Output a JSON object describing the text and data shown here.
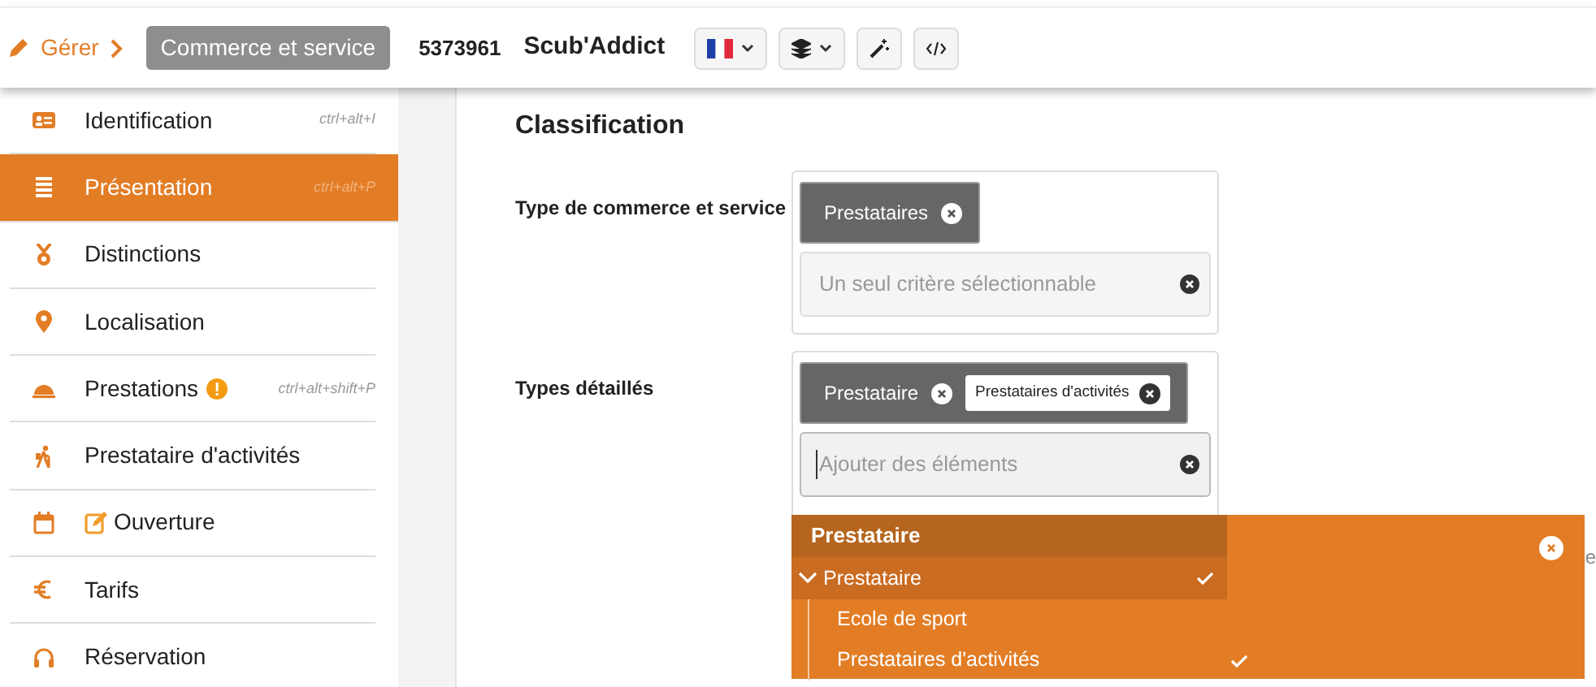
{
  "topbar": {
    "manage_link": "Gérer",
    "type_badge": "Commerce et service",
    "record_id": "5373961",
    "record_name": "Scub'Addict"
  },
  "sidebar": {
    "items": [
      {
        "label": "Identification",
        "shortcut": "ctrl+alt+I",
        "selected": false,
        "warning": false,
        "edit_marker": false
      },
      {
        "label": "Présentation",
        "shortcut": "ctrl+alt+P",
        "selected": true,
        "warning": false,
        "edit_marker": false
      },
      {
        "label": "Distinctions",
        "selected": false,
        "warning": false,
        "edit_marker": false
      },
      {
        "label": "Localisation",
        "selected": false,
        "warning": false,
        "edit_marker": false
      },
      {
        "label": "Prestations",
        "shortcut": "ctrl+alt+shift+P",
        "selected": false,
        "warning": true,
        "edit_marker": false
      },
      {
        "label": "Prestataire d'activités",
        "selected": false,
        "warning": false,
        "edit_marker": false
      },
      {
        "label": "Ouverture",
        "selected": false,
        "warning": false,
        "edit_marker": true
      },
      {
        "label": "Tarifs",
        "selected": false,
        "warning": false,
        "edit_marker": false
      },
      {
        "label": "Réservation",
        "selected": false,
        "warning": false,
        "edit_marker": false
      }
    ]
  },
  "section": {
    "title": "Classification",
    "fields": [
      {
        "label": "Type de commerce et service",
        "tags": [
          {
            "text": "Prestataires"
          }
        ],
        "placeholder": "Un seul critère sélectionnable",
        "focused": false
      },
      {
        "label": "Types détaillés",
        "tags": [
          {
            "text": "Prestataire",
            "children": [
              {
                "text": "Prestataires d'activités"
              }
            ]
          }
        ],
        "placeholder": "Ajouter des éléments",
        "focused": true
      }
    ]
  },
  "dropdown": {
    "header": "Prestataire",
    "options": [
      {
        "label": "Prestataire",
        "selected": true,
        "expanded": true,
        "children": [
          {
            "label": "Ecole de sport",
            "selected": false
          },
          {
            "label": "Prestataires d'activités",
            "selected": true
          }
        ]
      }
    ]
  },
  "partial_text": "e"
}
